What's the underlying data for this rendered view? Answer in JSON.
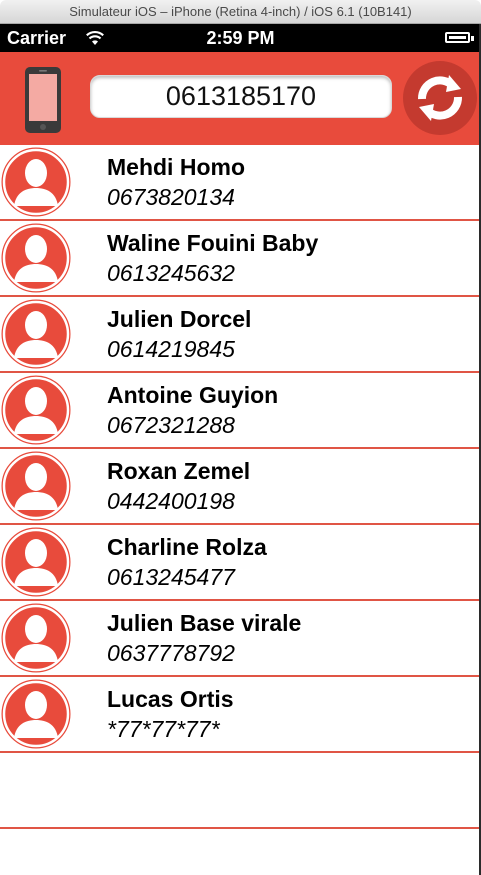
{
  "window": {
    "title": "Simulateur iOS – iPhone (Retina 4-inch) / iOS 6.1 (10B141)"
  },
  "status_bar": {
    "carrier": "Carrier",
    "time": "2:59 PM"
  },
  "header": {
    "phone_number": "0613185170",
    "accent_color": "#e84b3c"
  },
  "contacts": [
    {
      "name": "Mehdi Homo",
      "phone": "0673820134"
    },
    {
      "name": "Waline Fouini Baby",
      "phone": "0613245632"
    },
    {
      "name": "Julien Dorcel",
      "phone": "0614219845"
    },
    {
      "name": "Antoine Guyion",
      "phone": "0672321288"
    },
    {
      "name": "Roxan Zemel",
      "phone": "0442400198"
    },
    {
      "name": "Charline Rolza",
      "phone": "0613245477"
    },
    {
      "name": "Julien Base virale",
      "phone": "0637778792"
    },
    {
      "name": "Lucas Ortis",
      "phone": "*77*77*77*"
    }
  ],
  "icons": {
    "header_left": "phone-icon",
    "header_right": "refresh-icon",
    "row_avatar": "avatar-placeholder-icon"
  }
}
